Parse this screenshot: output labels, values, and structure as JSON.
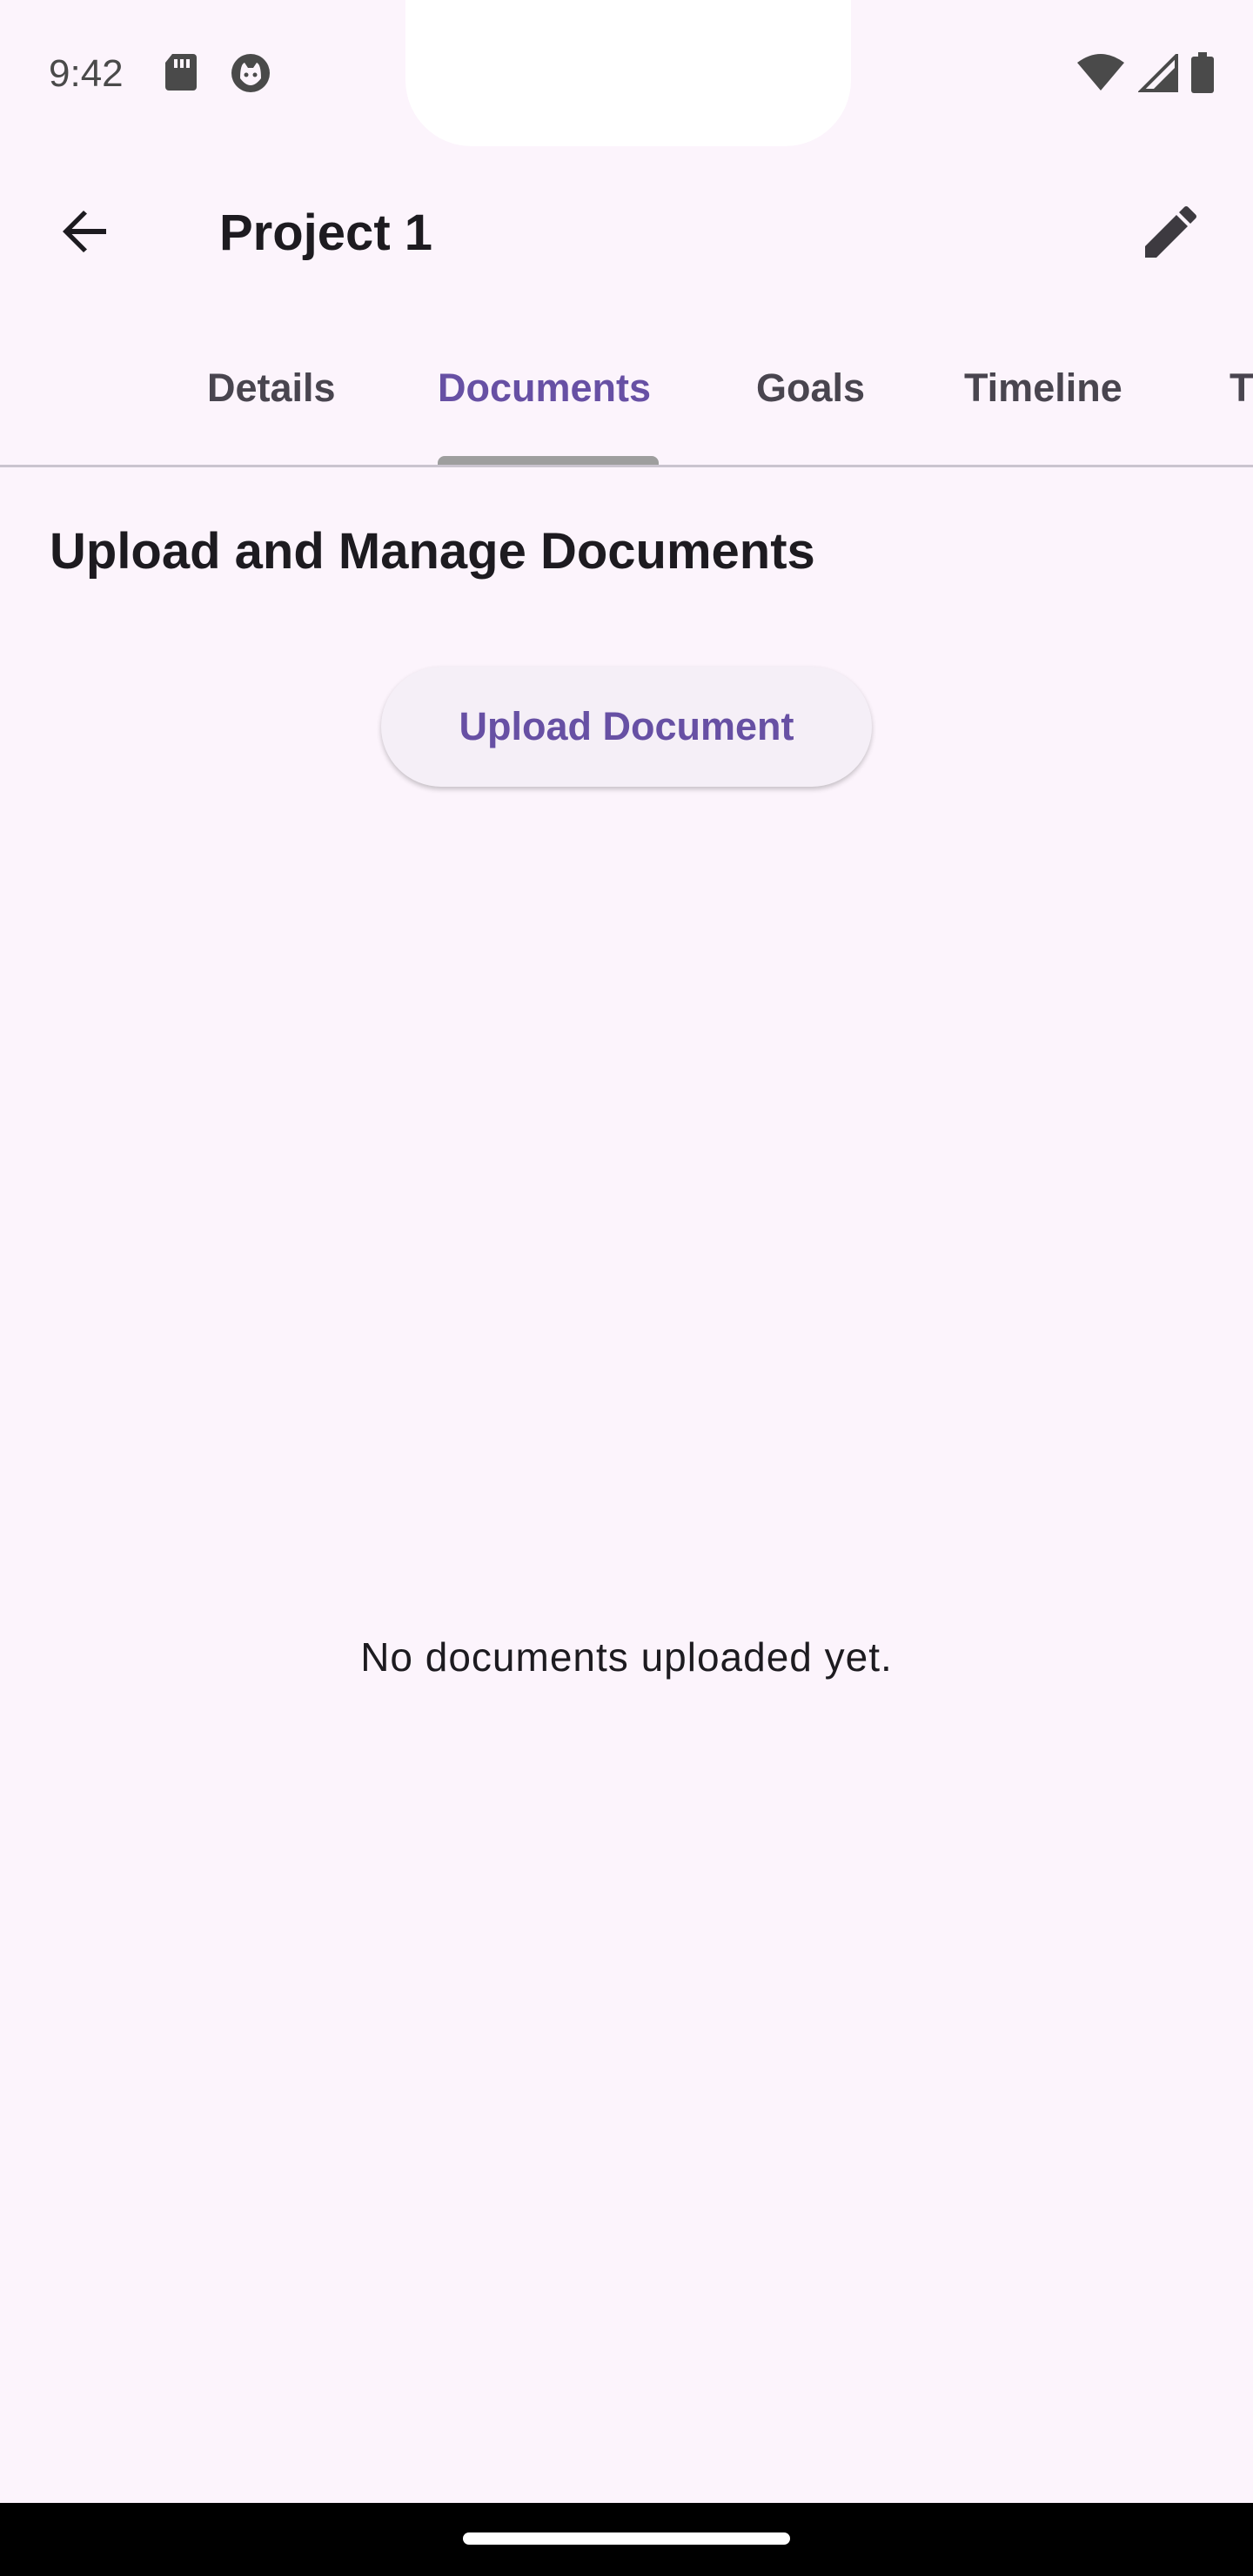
{
  "status_bar": {
    "time": "9:42",
    "icons_left": [
      "sd-card-icon",
      "cat-face-icon"
    ],
    "icons_right": [
      "wifi-icon",
      "cell-signal-icon",
      "battery-icon"
    ]
  },
  "app_bar": {
    "title": "Project 1",
    "back_icon": "arrow-back-icon",
    "edit_icon": "pencil-icon"
  },
  "tabs": [
    {
      "label": "Details",
      "active": false
    },
    {
      "label": "Documents",
      "active": true
    },
    {
      "label": "Goals",
      "active": false
    },
    {
      "label": "Timeline",
      "active": false
    },
    {
      "label": "T",
      "active": false
    }
  ],
  "content": {
    "heading": "Upload and Manage Documents",
    "upload_button": "Upload Document",
    "empty_message": "No documents uploaded yet."
  },
  "colors": {
    "background": "#fcf4fc",
    "accent": "#6750a4",
    "text_primary": "#1d1b20",
    "text_secondary": "#49454f"
  }
}
